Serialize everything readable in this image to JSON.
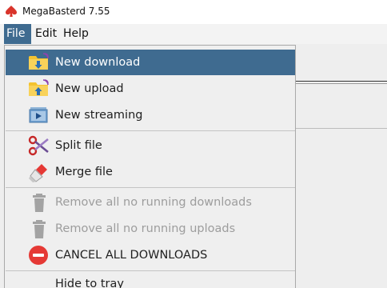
{
  "window": {
    "title": "MegaBasterd 7.55"
  },
  "menubar": {
    "file": "File",
    "edit": "Edit",
    "help": "Help"
  },
  "file_menu": {
    "new_download": "New download",
    "new_upload": "New upload",
    "new_streaming": "New streaming",
    "split_file": "Split file",
    "merge_file": "Merge file",
    "remove_downloads": "Remove all no running downloads",
    "remove_uploads": "Remove all no running uploads",
    "cancel_downloads": "CANCEL ALL DOWNLOADS",
    "hide_to_tray": "Hide to tray"
  },
  "colors": {
    "highlight": "#3f6b90",
    "folder": "#f4c330",
    "cancel_red": "#e53935",
    "disabled_text": "#9d9d9d"
  },
  "icons": {
    "app": "spade-icon",
    "new_download": "folder-download-icon",
    "new_upload": "folder-upload-icon",
    "new_streaming": "streaming-window-icon",
    "split_file": "scissors-icon",
    "merge_file": "glue-icon",
    "remove": "trash-icon",
    "cancel": "stop-icon"
  }
}
